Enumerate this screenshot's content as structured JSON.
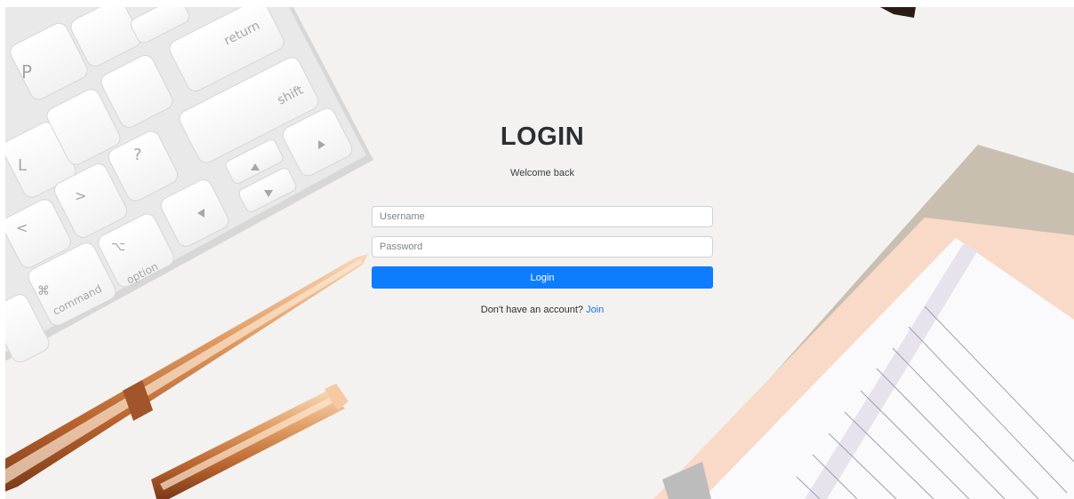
{
  "login": {
    "title": "LOGIN",
    "subtitle": "Welcome back",
    "username_placeholder": "Username",
    "password_placeholder": "Password",
    "button_label": "Login",
    "signup_prompt": "Don't have an account?",
    "signup_link": "Join"
  },
  "keyboard": {
    "key_return": "return",
    "key_shift": "shift",
    "key_command": "command",
    "key_option": "option",
    "key_p": "P",
    "key_l": "L",
    "key_lt": "<",
    "key_gt": ">",
    "key_question": "?",
    "key_command_symbol": "⌘",
    "key_option_symbol": "⌥"
  },
  "colors": {
    "primary": "#0d7dfd",
    "link": "#1a73e8",
    "background": "#f3f2f0"
  }
}
